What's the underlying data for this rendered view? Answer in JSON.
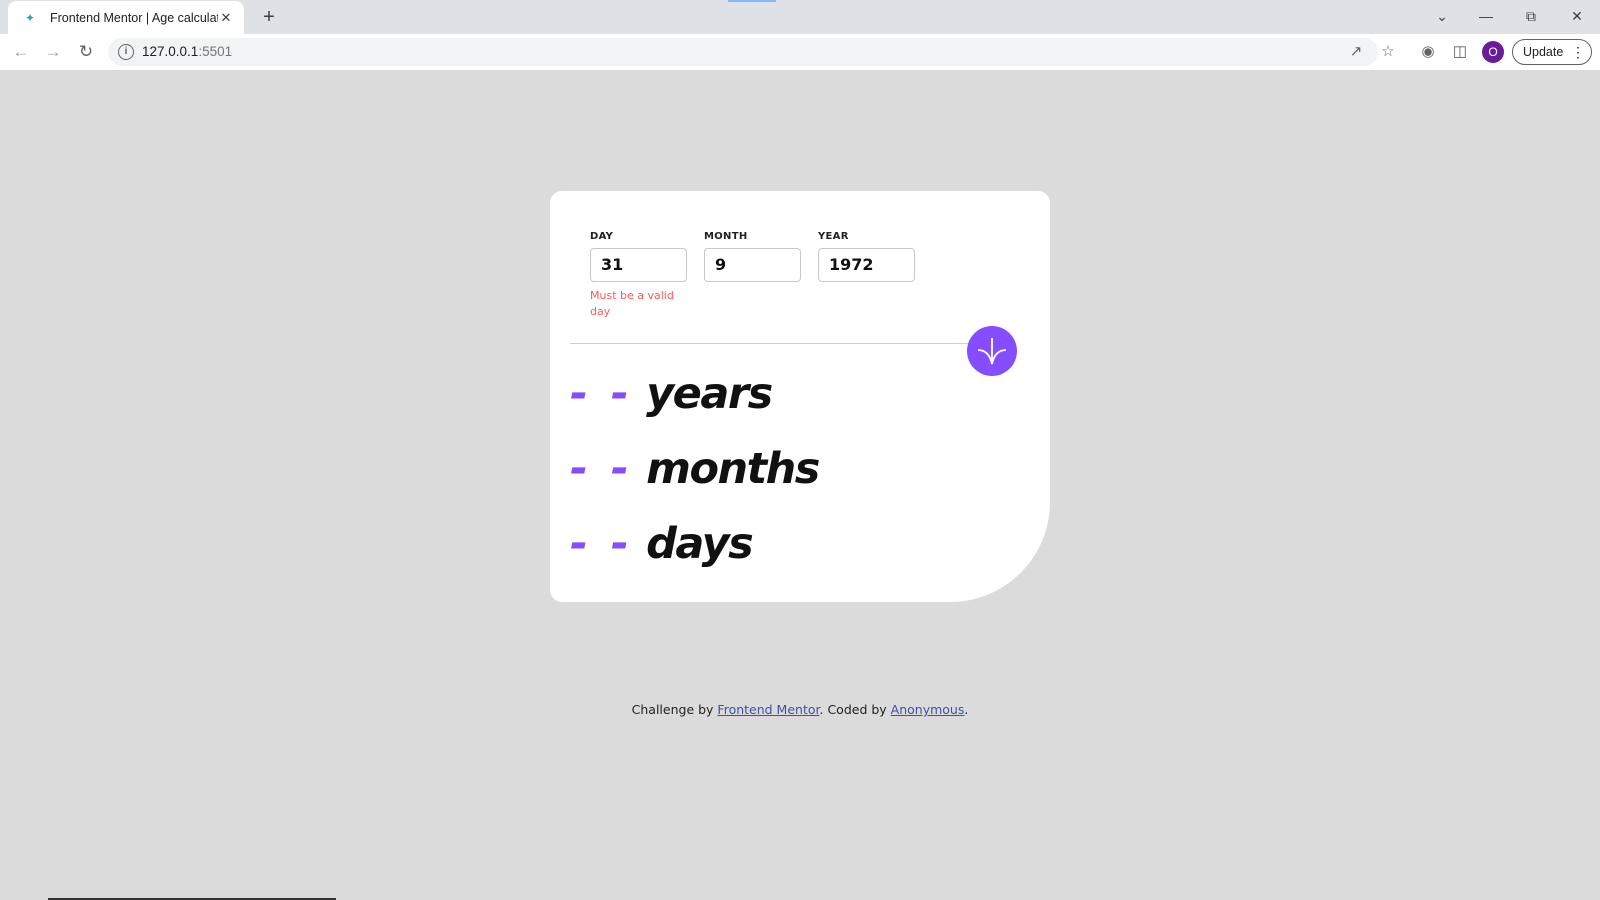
{
  "browser": {
    "tab_title": "Frontend Mentor | Age calculator",
    "url_host": "127.0.0.1",
    "url_port": ":5501",
    "update_label": "Update",
    "profile_initial": "O",
    "icons": [
      "back-icon",
      "forward-icon",
      "reload-icon",
      "info-icon",
      "share-icon",
      "star-icon",
      "extensions-icon",
      "sidepanel-icon",
      "tab-search-icon",
      "minimize-icon",
      "restore-icon",
      "close-icon"
    ]
  },
  "form": {
    "day": {
      "label": "DAY",
      "value": "31",
      "error": "Must be a valid day"
    },
    "month": {
      "label": "MONTH",
      "value": "9"
    },
    "year": {
      "label": "YEAR",
      "value": "1972"
    },
    "submit_icon": "arrow-down-icon"
  },
  "results": {
    "years": {
      "value": "- -",
      "unit": "years"
    },
    "months": {
      "value": "- -",
      "unit": "months"
    },
    "days": {
      "value": "- -",
      "unit": "days"
    }
  },
  "attribution": {
    "prefix": "Challenge by ",
    "link1": "Frontend Mentor",
    "middle": ". Coded by ",
    "link2": "Anonymous",
    "suffix": "."
  },
  "colors": {
    "accent": "#854dff",
    "error": "#ff5757",
    "page_bg": "#dbdbdb"
  }
}
